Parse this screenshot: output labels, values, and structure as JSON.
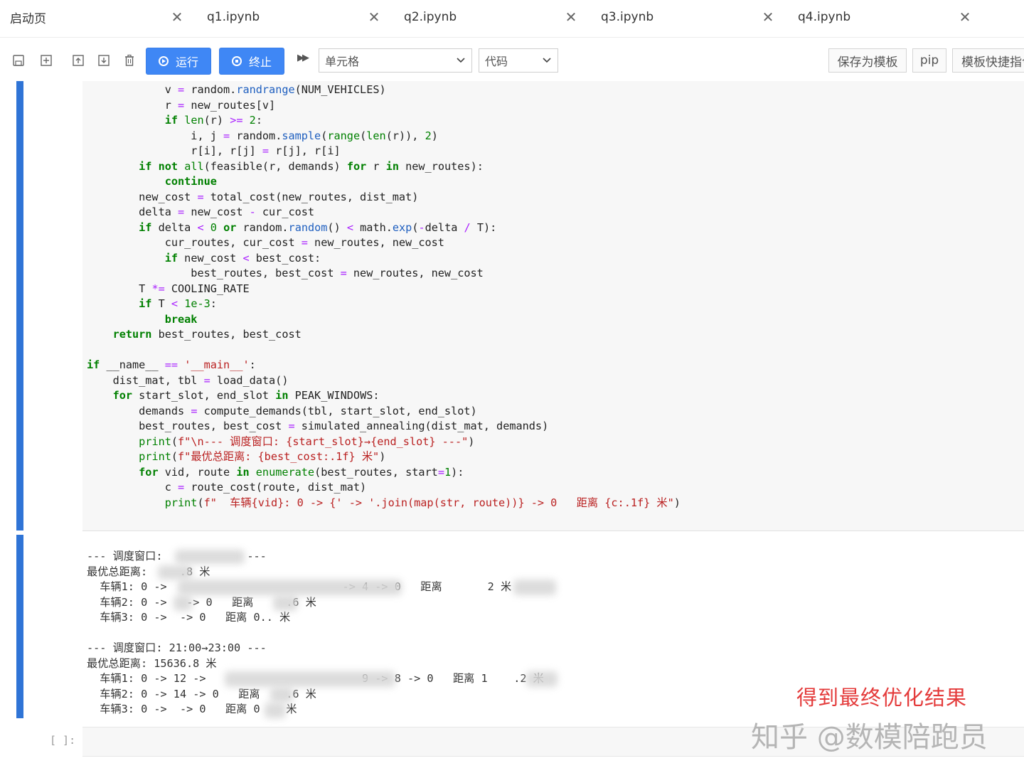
{
  "tabs": [
    {
      "label": "启动页"
    },
    {
      "label": "q1.ipynb"
    },
    {
      "label": "q2.ipynb"
    },
    {
      "label": "q3.ipynb"
    },
    {
      "label": "q4.ipynb"
    }
  ],
  "tab_close_glyph": "✕",
  "toolbar": {
    "run_label": "运行",
    "stop_label": "终止",
    "run_all_glyph": "▶▶",
    "cell_select_value": "单元格",
    "type_select_value": "代码",
    "save_template_label": "保存为模板",
    "pip_label": "pip",
    "template_shortcut_label": "模板快捷指令"
  },
  "icons": [
    "save-icon",
    "insert-cell-icon",
    "move-up-icon",
    "move-down-icon",
    "delete-icon",
    "run-icon",
    "stop-icon",
    "run-all-icon",
    "chevron-down-icon",
    "close-icon"
  ],
  "code": [
    "            v = random.randrange(NUM_VEHICLES)",
    "            r = new_routes[v]",
    "            if len(r) >= 2:",
    "                i, j = random.sample(range(len(r)), 2)",
    "                r[i], r[j] = r[j], r[i]",
    "        if not all(feasible(r, demands) for r in new_routes):",
    "            continue",
    "        new_cost = total_cost(new_routes, dist_mat)",
    "        delta = new_cost - cur_cost",
    "        if delta < 0 or random.random() < math.exp(-delta / T):",
    "            cur_routes, cur_cost = new_routes, new_cost",
    "            if new_cost < best_cost:",
    "                best_routes, best_cost = new_routes, new_cost",
    "        T *= COOLING_RATE",
    "        if T < 1e-3:",
    "            break",
    "    return best_routes, best_cost",
    "",
    "if __name__ == '__main__':",
    "    dist_mat, tbl = load_data()",
    "    for start_slot, end_slot in PEAK_WINDOWS:",
    "        demands = compute_demands(tbl, start_slot, end_slot)",
    "        best_routes, best_cost = simulated_annealing(dist_mat, demands)",
    "        print(f\"\\n--- 调度窗口: {start_slot}→{end_slot} ---\")",
    "        print(f\"最优总距离: {best_cost:.1f} 米\")",
    "        for vid, route in enumerate(best_routes, start=1):",
    "            c = route_cost(route, dist_mat)",
    "            print(f\"  车辆{vid}: 0 -> {' -> '.join(map(str, route))} -> 0   距离 {c:.1f} 米\")"
  ],
  "output": [
    "--- 调度窗口:             ---",
    "最优总距离:     .8 米",
    "  车辆1: 0 ->                           -> 4 -> 0   距离       2 米",
    "  车辆2: 0 ->   -> 0   距离     .6 米",
    "  车辆3: 0 ->  -> 0   距离 0.. 米",
    "",
    "--- 调度窗口: 21:00→23:00 ---",
    "最优总距离: 15636.8 米",
    "  车辆1: 0 -> 12 ->                        9 -> 8 -> 0   距离 1    .2 米",
    "  车辆2: 0 -> 14 -> 0   距离    .6 米",
    "  车辆3: 0 ->  -> 0   距离 0    米"
  ],
  "empty_prompt": "[ ]:",
  "annotation": "得到最终优化结果",
  "watermark": "知乎 @数模陪跑员"
}
